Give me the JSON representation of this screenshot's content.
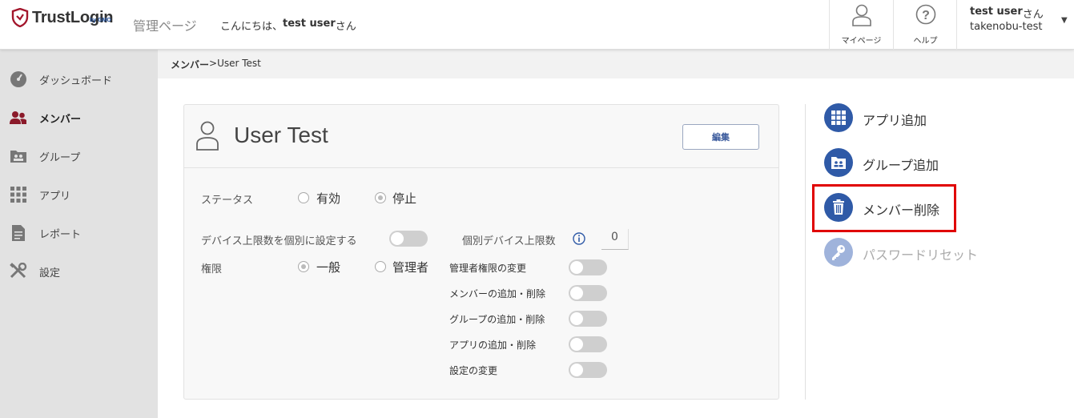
{
  "header": {
    "logo_text": "TrustLogin",
    "logo_sub": "by GMO",
    "admin_label": "管理ページ",
    "greeting_prefix": "こんにちは、",
    "greeting_user": "test user",
    "greeting_suffix": "さん",
    "mypage_label": "マイページ",
    "help_label": "ヘルプ",
    "user_name": "test user",
    "user_suffix": "さん",
    "tenant": "takenobu-test",
    "brand_color": "#a3162c"
  },
  "sidebar": {
    "items": [
      {
        "label": "ダッシュボード",
        "icon": "dashboard-icon"
      },
      {
        "label": "メンバー",
        "icon": "members-icon",
        "active": true
      },
      {
        "label": "グループ",
        "icon": "group-icon"
      },
      {
        "label": "アプリ",
        "icon": "apps-grid-icon"
      },
      {
        "label": "レポート",
        "icon": "report-icon"
      },
      {
        "label": "設定",
        "icon": "settings-tools-icon"
      }
    ]
  },
  "breadcrumb": {
    "root": "メンバー",
    "separator": " >",
    "current": "User Test"
  },
  "user_card": {
    "name": "User Test",
    "edit_label": "編集",
    "status_label": "ステータス",
    "status_options": [
      "有効",
      "停止"
    ],
    "status_selected": "停止",
    "device_limit_label": "デバイス上限数を個別に設定する",
    "device_limit_toggle": false,
    "individual_limit_label": "個別デバイス上限数",
    "individual_limit_value": "0",
    "role_label": "権限",
    "role_options": [
      "一般",
      "管理者"
    ],
    "role_selected": "一般",
    "permissions": [
      {
        "label": "管理者権限の変更",
        "enabled": false
      },
      {
        "label": "メンバーの追加・削除",
        "enabled": false
      },
      {
        "label": "グループの追加・削除",
        "enabled": false
      },
      {
        "label": "アプリの追加・削除",
        "enabled": false
      },
      {
        "label": "設定の変更",
        "enabled": false
      }
    ]
  },
  "actions": [
    {
      "label": "アプリ追加",
      "icon": "apps-grid-icon",
      "enabled": true
    },
    {
      "label": "グループ追加",
      "icon": "folder-group-icon",
      "enabled": true
    },
    {
      "label": "メンバー削除",
      "icon": "trash-icon",
      "enabled": true,
      "highlighted": true
    },
    {
      "label": "パスワードリセット",
      "icon": "key-icon",
      "enabled": false
    }
  ],
  "colors": {
    "action_blue": "#2f5aa7",
    "highlight_red": "#e00000",
    "sidebar_bg": "#e2e2e2"
  }
}
